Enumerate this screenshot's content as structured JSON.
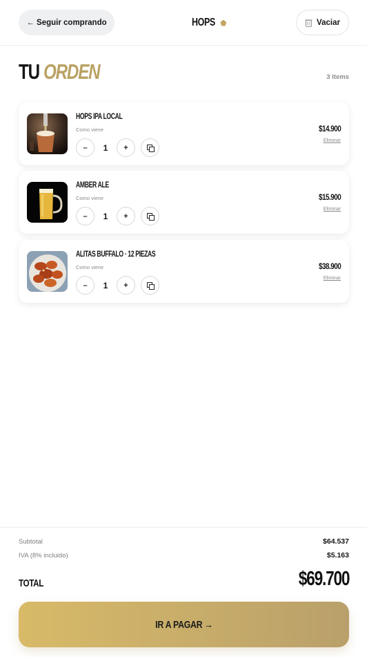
{
  "header": {
    "back_label": "← Seguir comprando",
    "logo_text": "HOPS",
    "clear_label": "Vaciar"
  },
  "order": {
    "title_first": "TU",
    "title_second": "ORDEN",
    "items_count": "3 items"
  },
  "items": [
    {
      "name": "HOPS IPA LOCAL",
      "note": "Como viene",
      "quantity": "1",
      "price": "$14.900",
      "remove_label": "Eliminar",
      "image": "beer-tap-photo"
    },
    {
      "name": "AMBER ALE",
      "note": "Como viene",
      "quantity": "1",
      "price": "$15.900",
      "remove_label": "Eliminar",
      "image": "beer-mug-photo"
    },
    {
      "name": "ALITAS BUFFALO · 12 PIEZAS",
      "note": "Como viene",
      "quantity": "1",
      "price": "$38.900",
      "remove_label": "Eliminar",
      "image": "buffalo-wings-photo"
    }
  ],
  "controls": {
    "minus": "–",
    "plus": "+"
  },
  "summary": {
    "subtotal_label": "Subtotal",
    "subtotal_value": "$64.537",
    "tax_label": "IVA (8% incluido)",
    "tax_value": "$5.163",
    "total_label": "TOTAL",
    "total_value": "$69.700"
  },
  "checkout": {
    "pay_label": "IR A PAGAR →"
  },
  "colors": {
    "accent_gold": "#c2a763",
    "text": "#161616",
    "muted": "#8a8a8a"
  }
}
